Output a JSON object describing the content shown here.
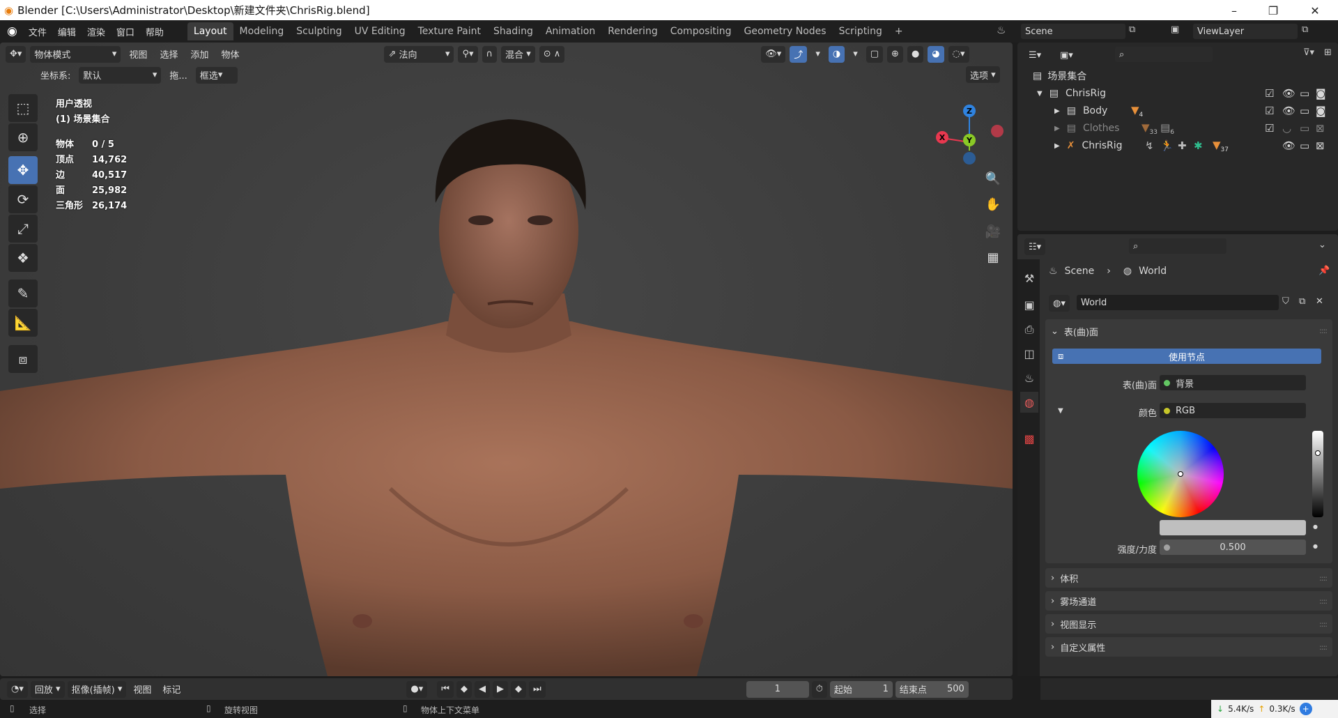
{
  "window": {
    "title": "Blender [C:\\Users\\Administrator\\Desktop\\新建文件夹\\ChrisRig.blend]",
    "minimize": "–",
    "maximize": "❐",
    "close": "✕"
  },
  "menubar": {
    "items": [
      "文件",
      "编辑",
      "渲染",
      "窗口",
      "帮助"
    ],
    "workspaces": [
      "Layout",
      "Modeling",
      "Sculpting",
      "UV Editing",
      "Texture Paint",
      "Shading",
      "Animation",
      "Rendering",
      "Compositing",
      "Geometry Nodes",
      "Scripting"
    ],
    "active_workspace": "Layout",
    "add_workspace": "+",
    "scene": "Scene",
    "view_layer": "ViewLayer"
  },
  "viewport": {
    "header": {
      "mode": "物体模式",
      "menus": [
        "视图",
        "选择",
        "添加",
        "物体"
      ],
      "orientation": "法向",
      "snap_label": "混合",
      "options": "选项"
    },
    "subheader": {
      "coord_label": "坐标系:",
      "coord_value": "默认",
      "drag_label": "拖...",
      "drag_value": "框选"
    },
    "overlay": {
      "view_name": "用户透视",
      "collection": "(1) 场景集合",
      "stats": [
        {
          "label": "物体",
          "value": "0 / 5"
        },
        {
          "label": "顶点",
          "value": "14,762"
        },
        {
          "label": "边",
          "value": "40,517"
        },
        {
          "label": "面",
          "value": "25,982"
        },
        {
          "label": "三角形",
          "value": "26,174"
        }
      ]
    },
    "gizmo": {
      "x": "X",
      "y": "Y",
      "z": "Z",
      "x_color": "#e8384f",
      "y_color": "#8ac926",
      "z_color": "#2f83e0"
    },
    "active_tool": "move"
  },
  "outliner": {
    "root": "场景集合",
    "items": [
      {
        "name": "ChrisRig",
        "type": "collection",
        "level": 0
      },
      {
        "name": "Body",
        "type": "collection",
        "level": 1,
        "badge": "4"
      },
      {
        "name": "Clothes",
        "type": "collection",
        "level": 1,
        "badge": "33",
        "badge2": "6",
        "dimmed": true
      },
      {
        "name": "ChrisRig",
        "type": "armature",
        "level": 1,
        "badge": "37"
      }
    ]
  },
  "properties": {
    "breadcrumb": [
      "Scene",
      "World"
    ],
    "world_name": "World",
    "surface_panel": {
      "title": "表(曲)面",
      "use_nodes": "使用节点",
      "surface_label": "表(曲)面",
      "surface_value": "背景",
      "color_label": "颜色",
      "color_value": "RGB",
      "strength_label": "强度/力度",
      "strength_value": "0.500"
    },
    "collapsed_panels": [
      "体积",
      "雾场通道",
      "视图显示",
      "自定义属性"
    ],
    "accent": "#4772b3"
  },
  "timeline": {
    "playback": "回放",
    "keying": "抠像(插帧)",
    "view": "视图",
    "marker": "标记",
    "current_frame": "1",
    "start_label": "起始",
    "start": "1",
    "end_label": "结束点",
    "end": "500"
  },
  "statusbar": {
    "select": "选择",
    "rotate": "旋转视图",
    "context_menu": "物体上下文菜单",
    "download": "5.4K/s",
    "upload": "0.3K/s"
  }
}
